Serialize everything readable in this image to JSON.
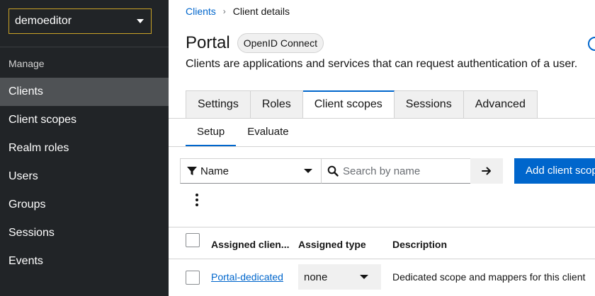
{
  "sidebar": {
    "realm": "demoeditor",
    "section": "Manage",
    "items": [
      {
        "label": "Clients",
        "active": true
      },
      {
        "label": "Client scopes",
        "active": false
      },
      {
        "label": "Realm roles",
        "active": false
      },
      {
        "label": "Users",
        "active": false
      },
      {
        "label": "Groups",
        "active": false
      },
      {
        "label": "Sessions",
        "active": false
      },
      {
        "label": "Events",
        "active": false
      }
    ]
  },
  "breadcrumb": {
    "parent": "Clients",
    "separator": "›",
    "current": "Client details"
  },
  "header": {
    "title": "Portal",
    "badge": "OpenID Connect",
    "subtitle": "Clients are applications and services that can request authentication of a user."
  },
  "tabs": [
    {
      "label": "Settings",
      "active": false
    },
    {
      "label": "Roles",
      "active": false
    },
    {
      "label": "Client scopes",
      "active": true
    },
    {
      "label": "Sessions",
      "active": false
    },
    {
      "label": "Advanced",
      "active": false
    }
  ],
  "subtabs": [
    {
      "label": "Setup",
      "active": true
    },
    {
      "label": "Evaluate",
      "active": false
    }
  ],
  "toolbar": {
    "filter_label": "Name",
    "search_placeholder": "Search by name",
    "add_button": "Add client scope"
  },
  "table": {
    "headers": [
      "Assigned clien...",
      "Assigned type",
      "Description"
    ],
    "rows": [
      {
        "name": "Portal-dedicated",
        "type": "none",
        "description": "Dedicated scope and mappers for this client"
      }
    ]
  },
  "colors": {
    "accent": "#0066cc",
    "sidebar_bg": "#212427",
    "sidebar_active": "#4f5255",
    "realm_border": "#c9a227"
  }
}
